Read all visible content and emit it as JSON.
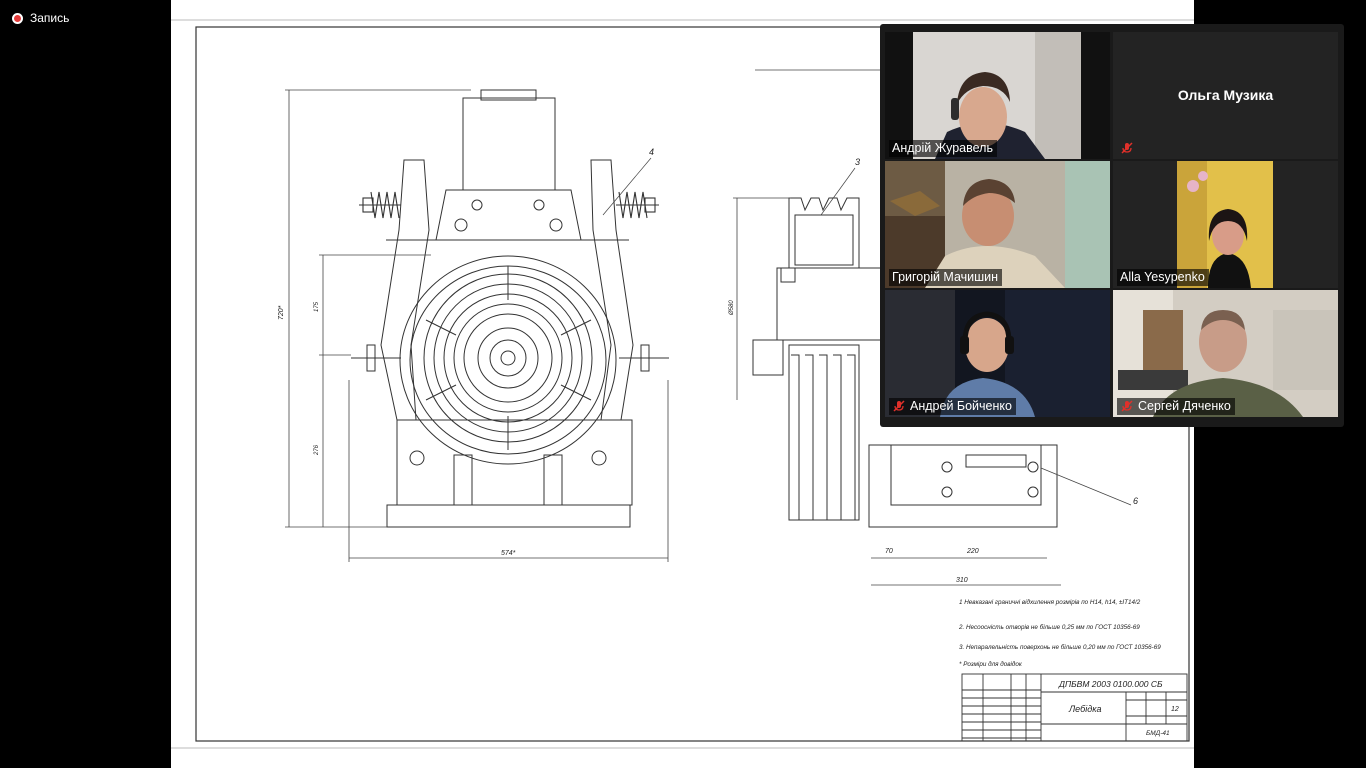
{
  "recording": {
    "label": "Запись"
  },
  "drawing": {
    "note1": "1 Невказані граничні відхилення розмірів  по Н14, h14,  ±IT14/2",
    "note2": "2. Несоосність отворів не більше 0,25 мм по ГОСТ 10356-69",
    "note3": "3. Непаралельність поверхонь не більше 0,20 мм по ГОСТ 10356-69",
    "note4": "* Розміри для довідок",
    "designation": "ДПБВМ 2003 0100.000 СБ",
    "title": "Лебідка",
    "sheet": "12",
    "org": "БМД-41",
    "dims": {
      "height": "720*",
      "d1": "175",
      "d2": "276",
      "width": "574*",
      "diam": "Ø580",
      "d70": "70",
      "d220": "220",
      "d310": "310"
    },
    "callouts": {
      "c3": "3",
      "c4": "4",
      "c6": "6"
    }
  },
  "participants": [
    {
      "name": "Андрій Журавель",
      "muted": false,
      "active": true,
      "video": true
    },
    {
      "name": "Ольга Музика",
      "muted": true,
      "active": false,
      "video": false
    },
    {
      "name": "Григорій Мачишин",
      "muted": false,
      "active": false,
      "video": true
    },
    {
      "name": "Alla Yesypenko",
      "muted": false,
      "active": false,
      "video": true
    },
    {
      "name": "Андрей Бойченко",
      "muted": true,
      "active": false,
      "video": true
    },
    {
      "name": "Сергей Дяченко",
      "muted": true,
      "active": false,
      "video": true
    }
  ],
  "colors": {
    "active_border": "#f0e05c",
    "mute_red": "#e0302a",
    "record_red": "#e53a3a"
  }
}
